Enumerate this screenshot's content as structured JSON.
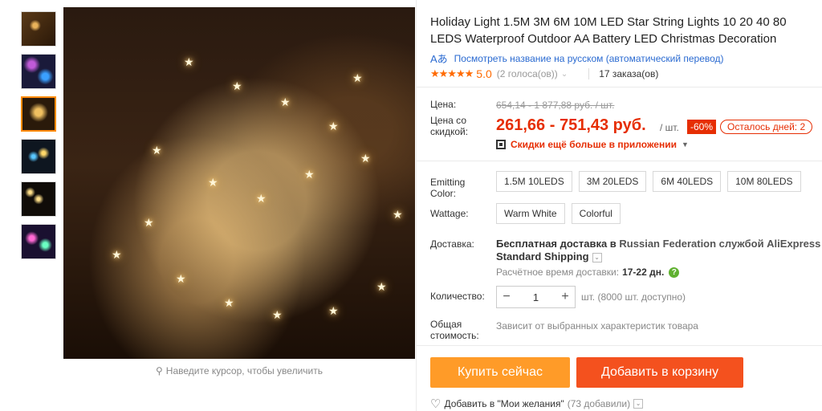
{
  "thumbnails": [
    {
      "alt": "thumb-1"
    },
    {
      "alt": "thumb-2"
    },
    {
      "alt": "thumb-3"
    },
    {
      "alt": "thumb-4"
    },
    {
      "alt": "thumb-5"
    },
    {
      "alt": "thumb-6"
    }
  ],
  "gallery": {
    "zoom_hint": "Наведите курсор, чтобы увеличить"
  },
  "product": {
    "title": "Holiday Light 1.5M 3M 6M 10M LED Star String Lights 10 20 40 80 LEDS Waterproof Outdoor AA Battery LED Christmas Decoration",
    "translate_link": "Посмотреть название на русском (автоматический перевод)",
    "stars": "★★★★★",
    "rating": "5.0",
    "votes": "(2 голоса(ов))",
    "orders": "17 заказа(ов)"
  },
  "price": {
    "label": "Цена:",
    "old": "654,14 - 1 877,88 руб. / шт.",
    "discount_label": "Цена со скидкой:",
    "new": "261,66 - 751,43 руб.",
    "per_unit": "/ шт.",
    "discount_badge": "-60%",
    "days_left": "Осталось дней: 2",
    "app_promo": "Скидки ещё больше в приложении"
  },
  "sku": {
    "color_label": "Emitting Color:",
    "color_options": [
      "1.5M 10LEDS",
      "3M 20LEDS",
      "6M 40LEDS",
      "10M 80LEDS"
    ],
    "wattage_label": "Wattage:",
    "wattage_options": [
      "Warm White",
      "Colorful"
    ]
  },
  "shipping": {
    "label": "Доставка:",
    "line1_a": "Бесплатная доставка в ",
    "line1_b": "Russian Federation службой AliExpress",
    "line2": "Standard Shipping",
    "time_label": "Расчётное время доставки:",
    "time_value": "17-22 дн."
  },
  "quantity": {
    "label": "Количество:",
    "value": "1",
    "minus": "−",
    "plus": "+",
    "available": "шт. (8000 шт. доступно)"
  },
  "total": {
    "label": "Общая стоимость:",
    "note": "Зависит от выбранных характеристик товара"
  },
  "actions": {
    "buy_now": "Купить сейчас",
    "add_to_cart": "Добавить в корзину",
    "wishlist": "Добавить в \"Мои желания\"",
    "wishlist_count": "(73 добавили)"
  },
  "colors": {
    "accent": "#e62e04",
    "buy": "#ff9b28",
    "cart": "#f4511e",
    "link": "#2a6ad1"
  }
}
